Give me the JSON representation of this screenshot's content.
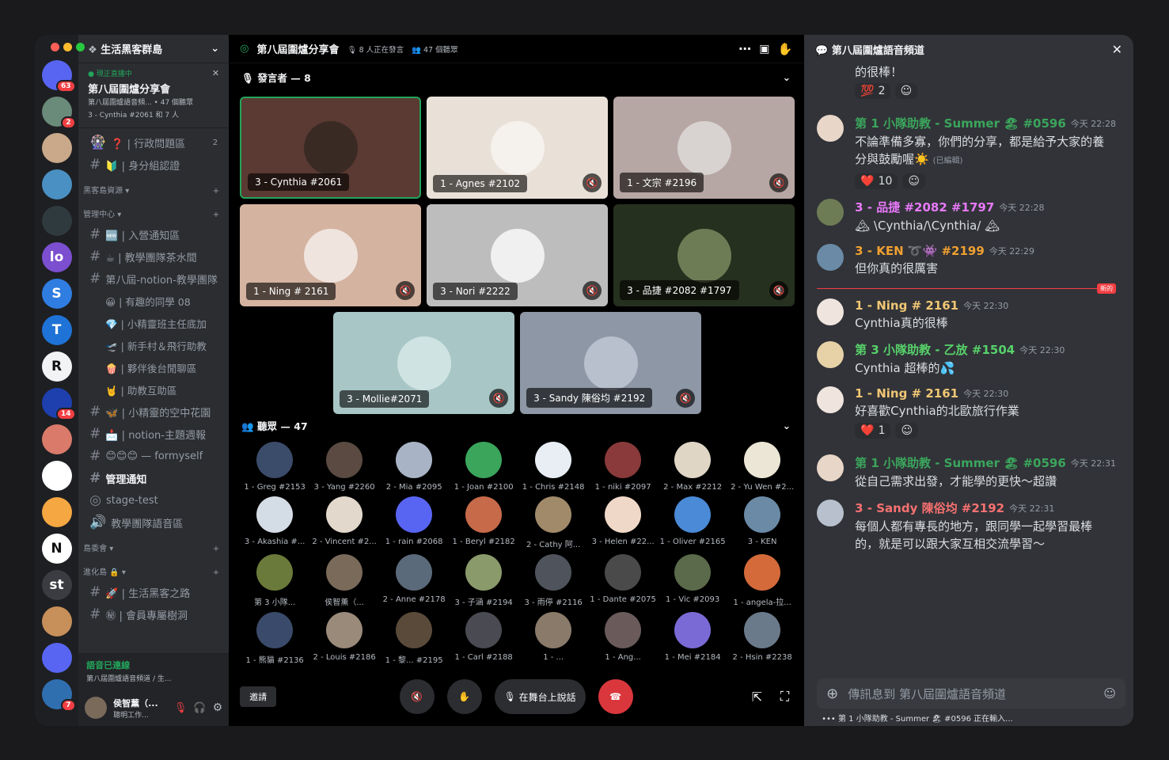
{
  "rail": {
    "servers": [
      {
        "icon": "discord-home-icon",
        "color": "#5865f2",
        "badge": "63"
      },
      {
        "icon": "server-landscape",
        "color": "#6a8a7a",
        "badge": "2"
      },
      {
        "icon": "server-avatar",
        "color": "#c9a98a",
        "badge": ""
      },
      {
        "icon": "server-mountain",
        "color": "#4a90c2",
        "badge": ""
      },
      {
        "icon": "server-pattern",
        "color": "#2f3a3f",
        "badge": ""
      },
      {
        "icon": "server-lo",
        "color": "#7b4fd0",
        "badge": "",
        "text": "lo"
      },
      {
        "icon": "server-s",
        "color": "#2f7de1",
        "badge": "",
        "text": "S"
      },
      {
        "icon": "server-t",
        "color": "#1f73d6",
        "badge": "",
        "text": "T"
      },
      {
        "icon": "server-r",
        "color": "#f2f3f5",
        "badge": "",
        "text": "R"
      },
      {
        "icon": "server-globe",
        "color": "#1e40af",
        "badge": "14"
      },
      {
        "icon": "server-monster",
        "color": "#d97a6a",
        "badge": ""
      },
      {
        "icon": "server-z",
        "color": "#ffffff",
        "badge": ""
      },
      {
        "icon": "server-home",
        "color": "#f5a742",
        "badge": ""
      },
      {
        "icon": "server-notion",
        "color": "#ffffff",
        "badge": "",
        "text": "N"
      },
      {
        "icon": "server-st",
        "color": "#3a3c42",
        "badge": "",
        "text": "st"
      },
      {
        "icon": "server-cat",
        "color": "#c78f5a",
        "badge": ""
      },
      {
        "icon": "server-folder",
        "color": "#5865f2",
        "badge": ""
      },
      {
        "icon": "server-bridge",
        "color": "#2f6fb0",
        "badge": "7"
      }
    ]
  },
  "sidebar": {
    "guild_name": "生活黑客群島",
    "live": {
      "tag": "現正直播中",
      "title": "第八屆圍爐分享會",
      "sub1": "第八屆圍爐語音頻... • 47 個聽眾",
      "sub2": "3 - Cynthia #2061 和 7 人"
    },
    "channels": [
      {
        "kind": "ch",
        "icon": "🎡",
        "label": "❓ | 行政問題區",
        "count": "2"
      },
      {
        "kind": "ch",
        "icon": "#",
        "label": "🔰 | 身分組認證"
      },
      {
        "kind": "cat",
        "label": "黑客島資源 ▾"
      },
      {
        "kind": "cat",
        "label": "管理中心 ▾"
      },
      {
        "kind": "ch",
        "icon": "#",
        "label": "🆕 | 入營通知區"
      },
      {
        "kind": "ch",
        "icon": "#",
        "label": "☕ | 教學團隊茶水間"
      },
      {
        "kind": "ch",
        "icon": "#",
        "label": "第八屆-notion-教學團隊"
      },
      {
        "kind": "sub",
        "label": "😀 | 有趣的同學 08"
      },
      {
        "kind": "sub",
        "label": "💎 | 小精靈班主任底加"
      },
      {
        "kind": "sub",
        "label": "🛫 | 新手村＆飛行助教"
      },
      {
        "kind": "sub",
        "label": "🍿 | 夥伴後台閒聊區"
      },
      {
        "kind": "sub",
        "label": "🤘 | 助教互助區"
      },
      {
        "kind": "ch",
        "icon": "#",
        "label": "🦋 | 小精靈的空中花園"
      },
      {
        "kind": "ch",
        "icon": "#",
        "label": "📩 | notion-主題週報"
      },
      {
        "kind": "ch",
        "icon": "#",
        "label": "😊😊😊 — formyself"
      },
      {
        "kind": "chb",
        "icon": "#",
        "label": "管理通知"
      },
      {
        "kind": "ch",
        "icon": "◎",
        "label": "stage-test"
      },
      {
        "kind": "ch",
        "icon": "🔊",
        "label": "教學團隊語音區"
      },
      {
        "kind": "cat",
        "label": "島委會 ▾"
      },
      {
        "kind": "cat",
        "label": "進化島 🔒 ▾"
      },
      {
        "kind": "ch",
        "icon": "#",
        "label": "🚀 | 生活黑客之路"
      },
      {
        "kind": "ch",
        "icon": "#",
        "label": "㊙ | 會員專屬樹洞"
      }
    ],
    "voice": {
      "status": "語音已連線",
      "channel": "第八屆圍爐語音頻道 / 生..."
    },
    "user": {
      "name": "侯智薰（...",
      "status": "聰明工作..."
    }
  },
  "stage": {
    "title": "第八屆圍爐分享會",
    "speaking": "8 人正在發言",
    "listeners": "47 個聽眾",
    "speakers_header": "發言者 — 8",
    "audience_header": "聽眾 — 47",
    "speakers": [
      {
        "name": "3 - Cynthia #2061",
        "bg": "#5a3a32",
        "face": "#3a2a24",
        "muted": false,
        "active": true
      },
      {
        "name": "1 - Agnes #2102",
        "bg": "#e9e1d8",
        "face": "#f5f1ec",
        "muted": true
      },
      {
        "name": "1 - 文宗 #2196",
        "bg": "#b7a7a4",
        "face": "#d8d3d1",
        "muted": true
      },
      {
        "name": "1 - Ning # 2161",
        "bg": "#d5b3a1",
        "face": "#efe4de",
        "muted": true
      },
      {
        "name": "3 - Nori #2222",
        "bg": "#bdbdbd",
        "face": "#f0f0f0",
        "muted": true
      },
      {
        "name": "3 - 品捷 #2082 #1797",
        "bg": "#26301f",
        "face": "#6d7c55",
        "muted": true
      },
      {
        "name": "3 - Mollie#2071",
        "bg": "#a9c6c6",
        "face": "#cfe3e3",
        "muted": true
      },
      {
        "name": "3 - Sandy 陳俗均 #2192",
        "bg": "#8d97a6",
        "face": "#b7c0cc",
        "muted": true
      }
    ],
    "audience": [
      {
        "name": "1 - Greg #2153",
        "c": "#3b4c6a"
      },
      {
        "name": "3 - Yang #2260",
        "c": "#5a4a42"
      },
      {
        "name": "2 - Mia #2095",
        "c": "#a8b4c6"
      },
      {
        "name": "1 - Joan #2100",
        "c": "#3ba55c"
      },
      {
        "name": "1 - Chris #2148",
        "c": "#e8eef4"
      },
      {
        "name": "1 - niki #2097",
        "c": "#8a3a3a"
      },
      {
        "name": "2 - Max #2212",
        "c": "#e0d6c6"
      },
      {
        "name": "2 - Yu Wen #2...",
        "c": "#ece6d6"
      },
      {
        "name": "3 - Akashia #...",
        "c": "#d4dce6"
      },
      {
        "name": "2 - Vincent #2...",
        "c": "#e2d8cc"
      },
      {
        "name": "1 - rain #2068",
        "c": "#5865f2"
      },
      {
        "name": "1 - Beryl #2182",
        "c": "#c76a4a"
      },
      {
        "name": "2 - Cathy 阿...",
        "c": "#a08a6a"
      },
      {
        "name": "3 - Helen #22...",
        "c": "#f0d8c8"
      },
      {
        "name": "1 - Oliver #2165",
        "c": "#4a8ad6"
      },
      {
        "name": "3 - KEN",
        "c": "#6a8aa6"
      },
      {
        "name": "第 3 小隊...",
        "c": "#6a7a3a"
      },
      {
        "name": "侯智薰（...",
        "c": "#7a6a5a"
      },
      {
        "name": "2 - Anne #2178",
        "c": "#5a6a7a"
      },
      {
        "name": "3 - 子涵 #2194",
        "c": "#8a9a6a"
      },
      {
        "name": "3 - 雨停 #2116",
        "c": "#4f545c"
      },
      {
        "name": "1 - Dante #2075",
        "c": "#4a4a4a"
      },
      {
        "name": "1 - Vic #2093",
        "c": "#5a6a4a"
      },
      {
        "name": "1 - angela-拉...",
        "c": "#d46a3a"
      },
      {
        "name": "1 - 熊貓 #2136",
        "c": "#3a4a6a"
      },
      {
        "name": "2 - Louis #2186",
        "c": "#9a8a7a"
      },
      {
        "name": "1 - 黎... #2195",
        "c": "#5a4a3a"
      },
      {
        "name": "1 - Carl #2188",
        "c": "#4a4a52"
      },
      {
        "name": "1 - ...",
        "c": "#8a7a6a"
      },
      {
        "name": "1 - Ang...",
        "c": "#6a5a5a"
      },
      {
        "name": "1 - Mei #2184",
        "c": "#7a6ad6"
      },
      {
        "name": "2 - Hsin #2238",
        "c": "#6a7a8a"
      }
    ],
    "invite": "邀請",
    "stage_talk": "在舞台上說話"
  },
  "chat": {
    "title": "第八屆圍爐語音頻道",
    "top_text": "的很棒！",
    "top_react": {
      "emoji": "💯",
      "count": "2"
    },
    "messages": [
      {
        "author": "第 1 小隊助教 - Summer 🏖 #0596",
        "color": "#3ba55c",
        "avcolor": "#e8d6c8",
        "time": "今天 22:28",
        "text": "不論準備多寡，你們的分享，都是給予大家的養分與鼓勵喔☀️",
        "edited": "(已編輯)",
        "react": {
          "emoji": "❤️",
          "count": "10"
        },
        "timeline": true
      },
      {
        "author": "3 - 品捷 #2082 #1797",
        "color": "#e879f9",
        "avcolor": "#6d7c55",
        "time": "今天 22:28",
        "text": "🏔 \\Cynthia/\\Cynthia/ 🏔"
      },
      {
        "author": "3 - KEN ➰👾 #2199",
        "color": "#f0a030",
        "avcolor": "#6a8aa6",
        "time": "今天 22:29",
        "text": "但你真的很厲害"
      },
      {
        "author": "1 - Ning # 2161",
        "color": "#f0c674",
        "avcolor": "#efe4de",
        "time": "今天 22:30",
        "text": "Cynthia真的很棒"
      },
      {
        "author": "第 3 小隊助教 - 乙放 #1504",
        "color": "#57d16a",
        "avcolor": "#e6d2a6",
        "time": "今天 22:30",
        "text": "Cynthia 超棒的💦"
      },
      {
        "author": "1 - Ning # 2161",
        "color": "#f0c674",
        "avcolor": "#efe4de",
        "time": "今天 22:30",
        "text": "好喜歡Cynthia的北歐旅行作業",
        "react": {
          "emoji": "❤️",
          "count": "1"
        }
      },
      {
        "author": "第 1 小隊助教 - Summer 🏖 #0596",
        "color": "#3ba55c",
        "avcolor": "#e8d6c8",
        "time": "今天 22:31",
        "text": "從自己需求出發，才能學的更快～超讚",
        "timeline": true
      },
      {
        "author": "3 - Sandy 陳俗均 #2192",
        "color": "#f87171",
        "avcolor": "#b7c0cc",
        "time": "今天 22:31",
        "text": "每個人都有專長的地方，跟同學一起學習最棒的，就是可以跟大家互相交流學習～"
      }
    ],
    "new_label": "新的",
    "placeholder": "傳訊息到 第八屆圍爐語音頻道",
    "typing": "第 1 小隊助教 - Summer 🏖 #0596 正在輸入..."
  }
}
